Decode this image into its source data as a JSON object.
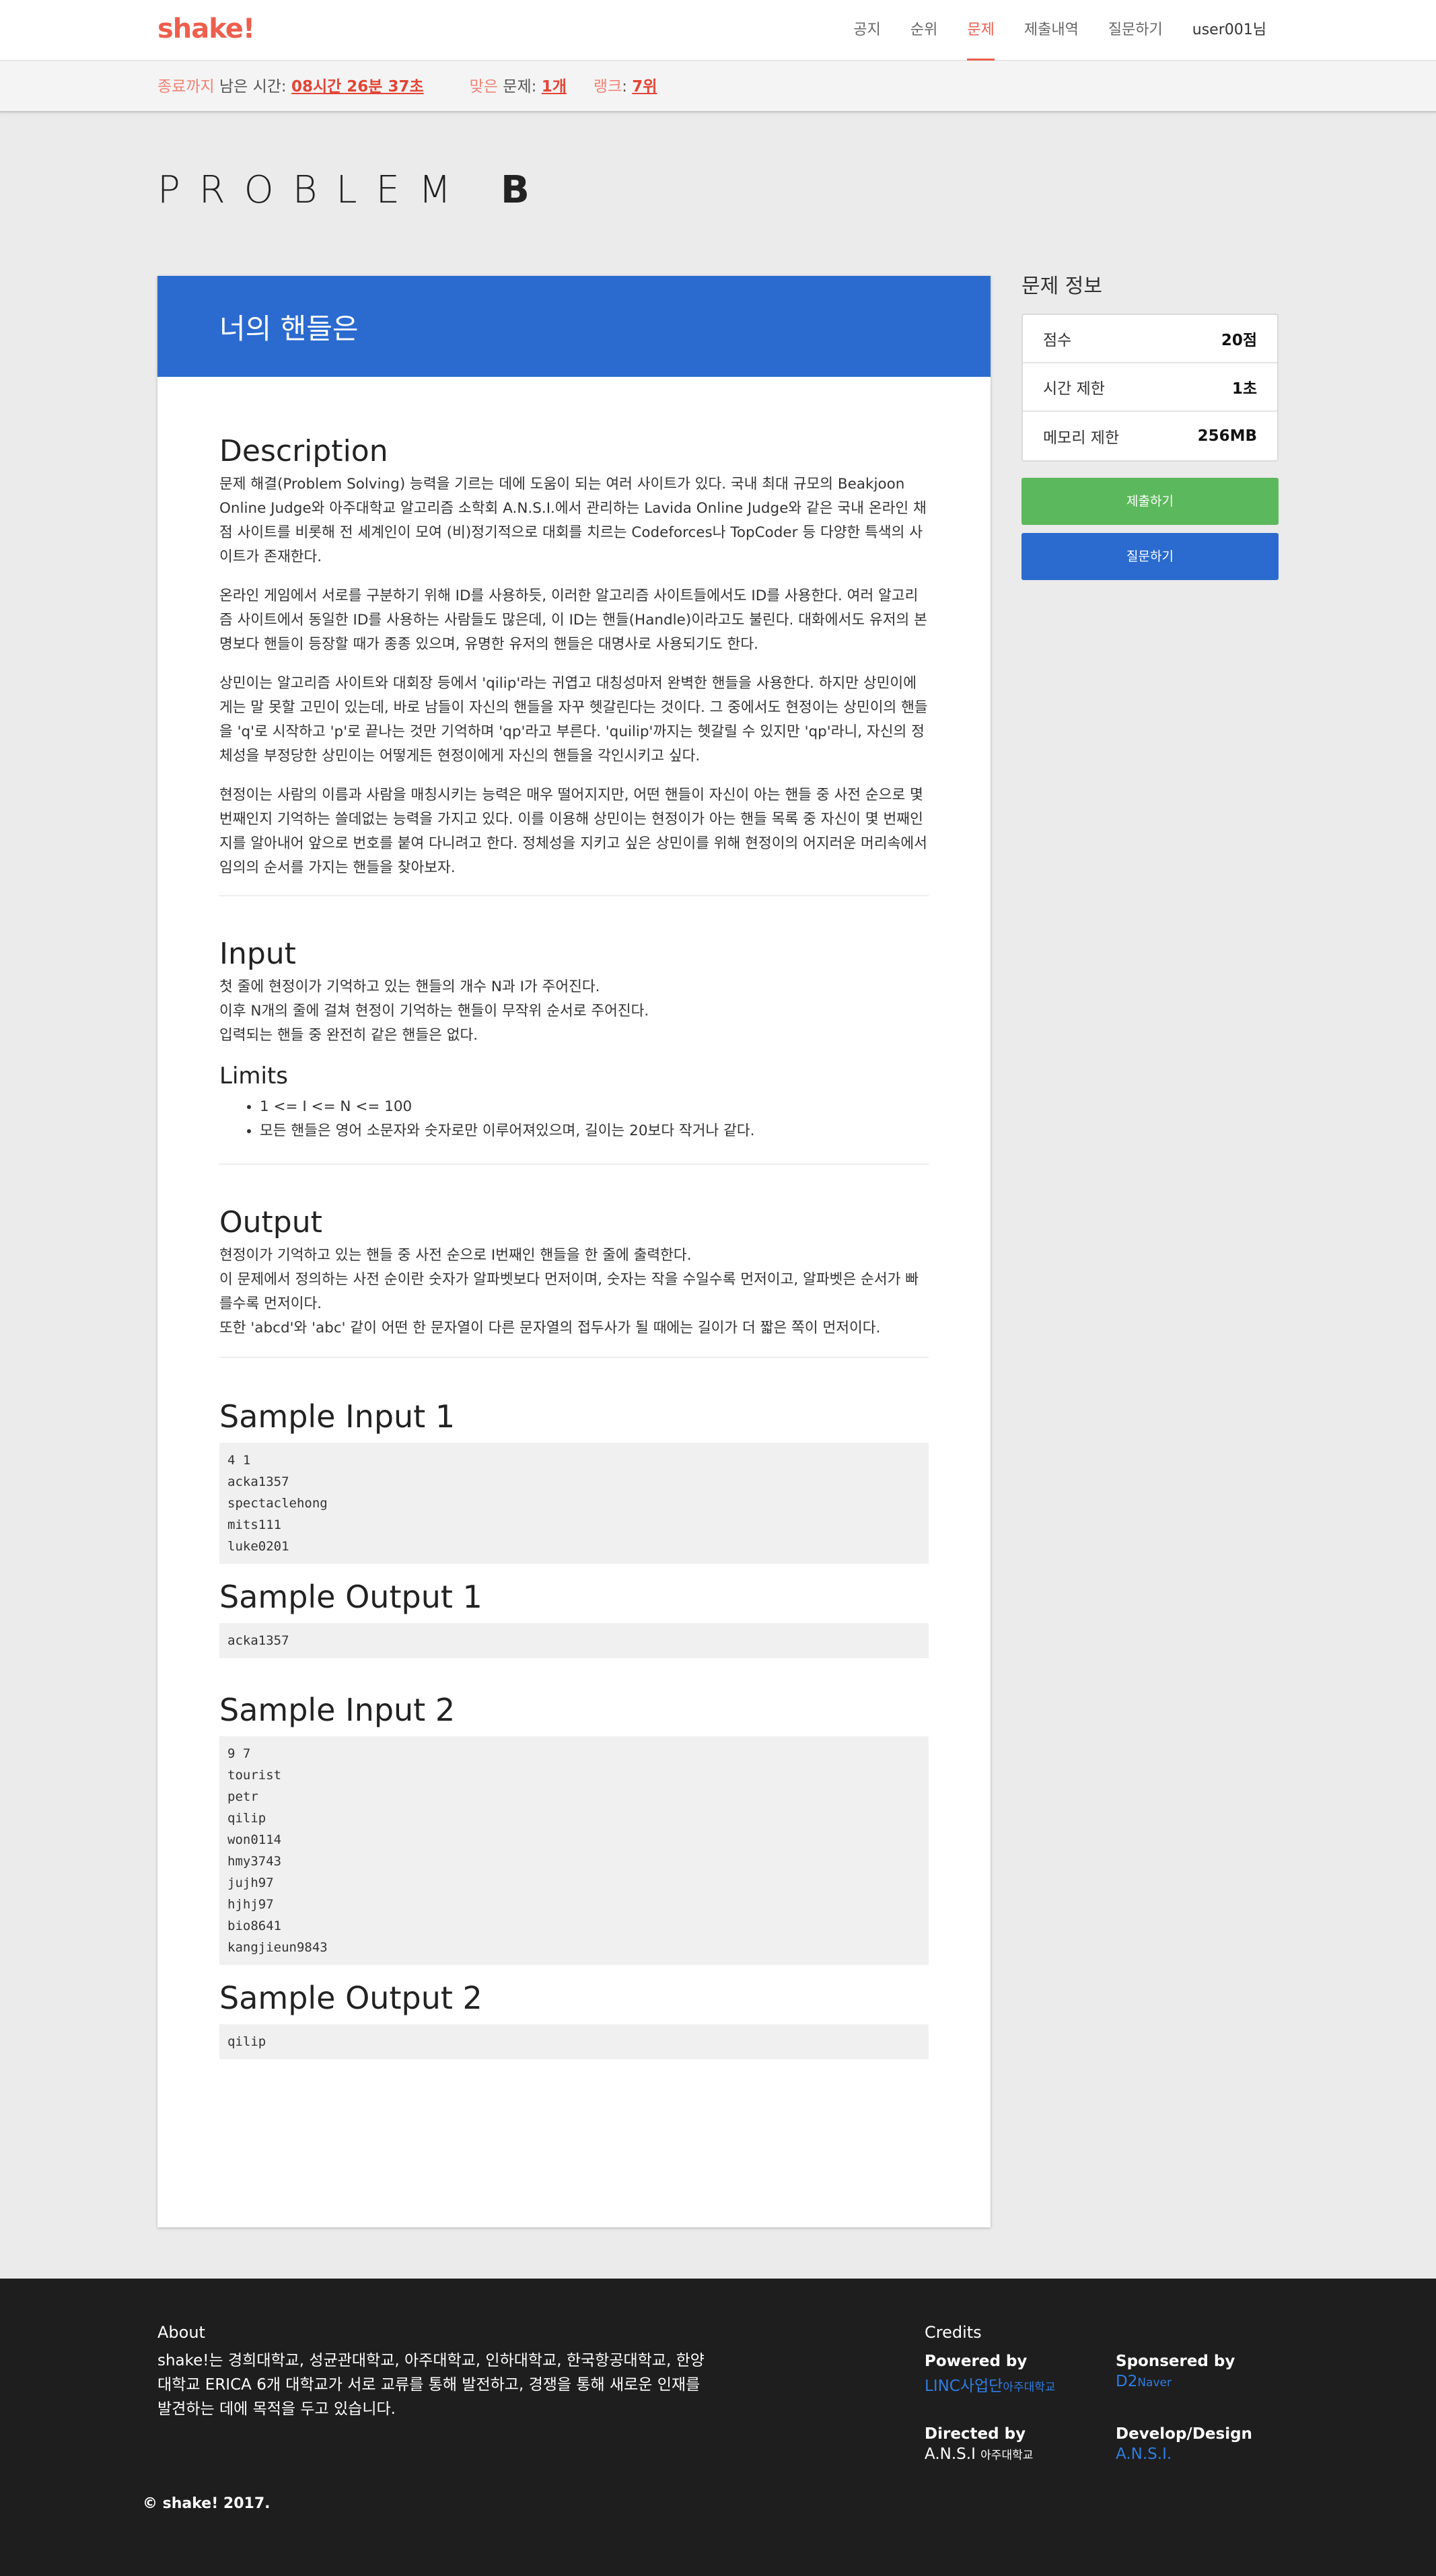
{
  "nav": {
    "logo": "shake!",
    "items": [
      "공지",
      "순위",
      "문제",
      "제출내역",
      "질문하기"
    ],
    "active_index": 2,
    "user": "user001님"
  },
  "status": {
    "end_label": "종료까지",
    "remaining_label": "남은 시간:",
    "remaining_value": "08시간 26분 37초",
    "solved_label_red": "맞은",
    "solved_label": "문제:",
    "solved_value": "1개",
    "rank_label": "랭크",
    "rank_value": "7위"
  },
  "problem": {
    "label": "PROBLEM",
    "letter": "B",
    "name": "너의 핸들은",
    "description_title": "Description",
    "description": [
      "문제 해결(Problem Solving) 능력을 기르는 데에 도움이 되는 여러 사이트가 있다. 국내 최대 규모의 Beakjoon Online Judge와 아주대학교 알고리즘 소학회 A.N.S.I.에서 관리하는 Lavida Online Judge와 같은 국내 온라인 채점 사이트를 비롯해 전 세계인이 모여 (비)정기적으로 대회를 치르는 Codeforces나 TopCoder 등 다양한 특색의 사이트가 존재한다.",
      "온라인 게임에서 서로를 구분하기 위해 ID를 사용하듯, 이러한 알고리즘 사이트들에서도 ID를 사용한다. 여러 알고리즘 사이트에서 동일한 ID를 사용하는 사람들도 많은데, 이 ID는 핸들(Handle)이라고도 불린다. 대화에서도 유저의 본명보다 핸들이 등장할 때가 종종 있으며, 유명한 유저의 핸들은 대명사로 사용되기도 한다.",
      "상민이는 알고리즘 사이트와 대회장 등에서 'qilip'라는 귀엽고 대칭성마저 완벽한 핸들을 사용한다. 하지만 상민이에게는 말 못할 고민이 있는데, 바로 남들이 자신의 핸들을 자꾸 헷갈린다는 것이다. 그 중에서도 현정이는 상민이의 핸들을 'q'로 시작하고 'p'로 끝나는 것만 기억하며 'qp'라고 부른다. 'quilip'까지는 헷갈릴 수 있지만 'qp'라니, 자신의 정체성을 부정당한 상민이는 어떻게든 현정이에게 자신의 핸들을 각인시키고 싶다.",
      "현정이는 사람의 이름과 사람을 매칭시키는 능력은 매우 떨어지지만, 어떤 핸들이 자신이 아는 핸들 중 사전 순으로 몇 번째인지 기억하는 쓸데없는 능력을 가지고 있다. 이를 이용해 상민이는 현정이가 아는 핸들 목록 중 자신이 몇 번째인지를 알아내어 앞으로 번호를 붙여 다니려고 한다. 정체성을 지키고 싶은 상민이를 위해 현정이의 어지러운 머리속에서 임의의 순서를 가지는 핸들을 찾아보자."
    ],
    "input_title": "Input",
    "input_lines": [
      "첫 줄에 현정이가 기억하고 있는 핸들의 개수 N과 I가 주어진다.",
      "이후 N개의 줄에 걸쳐 현정이 기억하는 핸들이 무작위 순서로 주어진다.",
      "입력되는 핸들 중 완전히 같은 핸들은 없다."
    ],
    "limits_title": "Limits",
    "limits": [
      "1 <= I <= N <= 100",
      "모든 핸들은 영어 소문자와 숫자로만 이루어져있으며, 길이는 20보다 작거나 같다."
    ],
    "output_title": "Output",
    "output_lines": [
      "현정이가 기억하고 있는 핸들 중 사전 순으로 I번째인 핸들을 한 줄에 출력한다.",
      "이 문제에서 정의하는 사전 순이란 숫자가 알파벳보다 먼저이며, 숫자는 작을 수일수록 먼저이고, 알파벳은 순서가 빠를수록 먼저이다.",
      "또한 'abcd'와 'abc' 같이 어떤 한 문자열이 다른 문자열의 접두사가 될 때에는 길이가 더 짧은 쪽이 먼저이다."
    ],
    "samples": [
      {
        "input_title": "Sample Input 1",
        "input": "4 1\nacka1357\nspectaclehong\nmits111\nluke0201",
        "output_title": "Sample Output 1",
        "output": "acka1357"
      },
      {
        "input_title": "Sample Input 2",
        "input": "9 7\ntourist\npetr\nqilip\nwon0114\nhmy3743\njujh97\nhjhj97\nbio8641\nkangjieun9843",
        "output_title": "Sample Output 2",
        "output": "qilip"
      }
    ]
  },
  "sidebar": {
    "title": "문제 정보",
    "rows": [
      {
        "key": "점수",
        "value": "20점"
      },
      {
        "key": "시간 제한",
        "value": "1초"
      },
      {
        "key": "메모리 제한",
        "value": "256MB"
      }
    ],
    "submit_label": "제출하기",
    "ask_label": "질문하기",
    "colors": {
      "submit": "#5cb85c",
      "ask": "#2b6bcf"
    }
  },
  "footer": {
    "about_title": "About",
    "about_text": "shake!는 경희대학교, 성균관대학교, 아주대학교, 인하대학교, 한국항공대학교, 한양대학교 ERICA 6개 대학교가 서로 교류를 통해 발전하고, 경쟁을 통해 새로운 인재를 발견하는 데에 목적을 두고 있습니다.",
    "credits_title": "Credits",
    "powered_by_label": "Powered by",
    "powered_by_value": "LINC사업단",
    "powered_by_small": "아주대학교",
    "sponsored_by_label": "Sponsered by",
    "sponsored_by_value": "D2",
    "sponsored_by_small": "Naver",
    "directed_by_label": "Directed by",
    "directed_by_value": "A.N.S.I",
    "directed_by_small": "아주대학교",
    "develop_label": "Develop/Design",
    "develop_value": "A.N.S.I.",
    "copyright": "© shake! 2017."
  }
}
